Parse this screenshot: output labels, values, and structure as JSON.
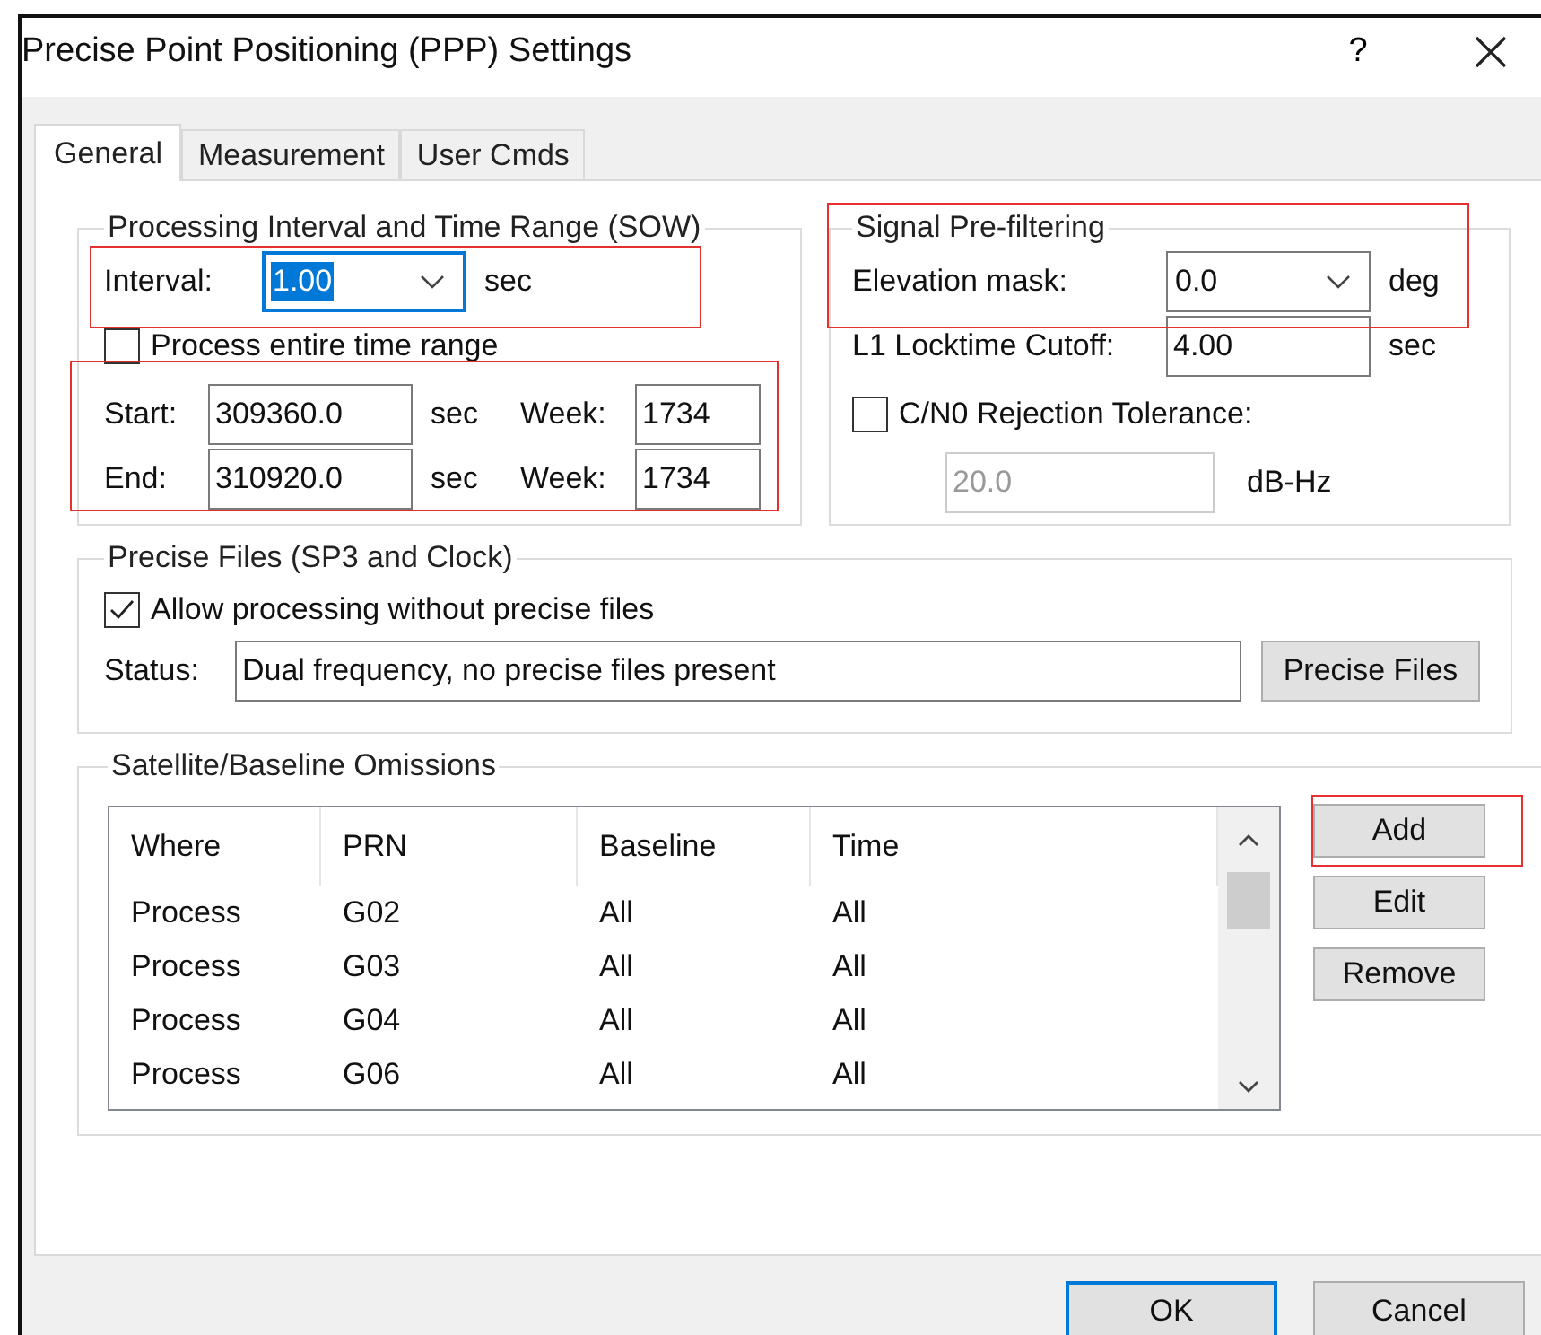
{
  "window": {
    "title": "Precise Point Positioning (PPP) Settings",
    "help": "?"
  },
  "tabs": [
    {
      "label": "General",
      "selected": true
    },
    {
      "label": "Measurement",
      "selected": false
    },
    {
      "label": "User Cmds",
      "selected": false
    }
  ],
  "processing": {
    "legend": "Processing Interval and Time Range (SOW)",
    "interval": {
      "label": "Interval:",
      "value": "1.00",
      "unit": "sec",
      "focused": true,
      "highlighted": true
    },
    "entire_range": {
      "label": "Process entire time range",
      "checked": false
    },
    "range_highlighted": true,
    "start": {
      "label": "Start:",
      "value": "309360.0",
      "unit": "sec",
      "week_label": "Week:",
      "week": "1734"
    },
    "end": {
      "label": "End:",
      "value": "310920.0",
      "unit": "sec",
      "week_label": "Week:",
      "week": "1734"
    }
  },
  "prefilter": {
    "legend": "Signal Pre-filtering",
    "highlighted": true,
    "elevation": {
      "label": "Elevation mask:",
      "value": "0.0",
      "unit": "deg"
    },
    "locktime": {
      "label": "L1 Locktime Cutoff:",
      "value": "4.00",
      "unit": "sec"
    },
    "cn0": {
      "label": "C/N0 Rejection Tolerance:",
      "checked": false,
      "value": "20.0",
      "unit": "dB-Hz",
      "disabled": true
    }
  },
  "precise_files": {
    "legend": "Precise Files (SP3 and Clock)",
    "allow": {
      "label": "Allow processing without precise files",
      "checked": true
    },
    "status_label": "Status:",
    "status": "Dual frequency, no precise files present",
    "button": "Precise Files"
  },
  "omissions": {
    "legend": "Satellite/Baseline Omissions",
    "columns": [
      "Where",
      "PRN",
      "Baseline",
      "Time"
    ],
    "rows": [
      [
        "Process",
        "G02",
        "All",
        "All"
      ],
      [
        "Process",
        "G03",
        "All",
        "All"
      ],
      [
        "Process",
        "G04",
        "All",
        "All"
      ],
      [
        "Process",
        "G06",
        "All",
        "All"
      ]
    ],
    "buttons": [
      {
        "label": "Add",
        "highlighted": true
      },
      {
        "label": "Edit",
        "highlighted": false
      },
      {
        "label": "Remove",
        "highlighted": false
      }
    ]
  },
  "footer": [
    {
      "label": "OK",
      "default": true
    },
    {
      "label": "Cancel",
      "default": false
    }
  ]
}
